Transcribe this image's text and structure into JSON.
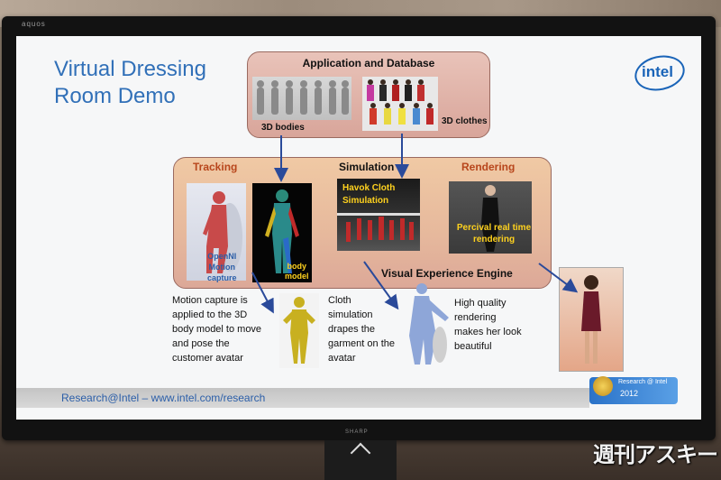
{
  "slide": {
    "title_line1": "Virtual Dressing",
    "title_line2": "Room Demo",
    "logo": "intel",
    "app_box": {
      "title": "Application and Database",
      "label_bodies": "3D bodies",
      "label_clothes": "3D clothes"
    },
    "engine_box": {
      "tracking": "Tracking",
      "simulation": "Simulation",
      "rendering": "Rendering",
      "footer": "Visual Experience Engine",
      "openni_l1": "OpenNI",
      "openni_l2": "Motion",
      "openni_l3": "capture",
      "body_l1": "body",
      "body_l2": "model",
      "havok_l1": "Havok Cloth",
      "havok_l2": "Simulation",
      "render_l1": "Percival real time",
      "render_l2": "rendering"
    },
    "descriptions": {
      "motion": [
        "Motion capture is",
        "applied to the 3D",
        "body model to move",
        "and pose the",
        "customer avatar"
      ],
      "cloth": [
        "Cloth",
        "simulation",
        "drapes the",
        "garment on the",
        "avatar"
      ],
      "render": [
        "High quality",
        "rendering",
        "makes her look",
        "beautiful"
      ]
    },
    "footer_text": "Research@Intel – www.intel.com/research",
    "badge_l1": "Research @ Intel",
    "badge_l2": "2012"
  },
  "tv": {
    "brand_top": "aquos",
    "brand_bottom": "SHARP"
  },
  "watermark": "週刊アスキー",
  "colors": {
    "title_blue": "#3170b8",
    "accent_orange": "#b8461c",
    "label_yellow": "#ffd21e",
    "arrow_blue": "#2a4a9a"
  }
}
